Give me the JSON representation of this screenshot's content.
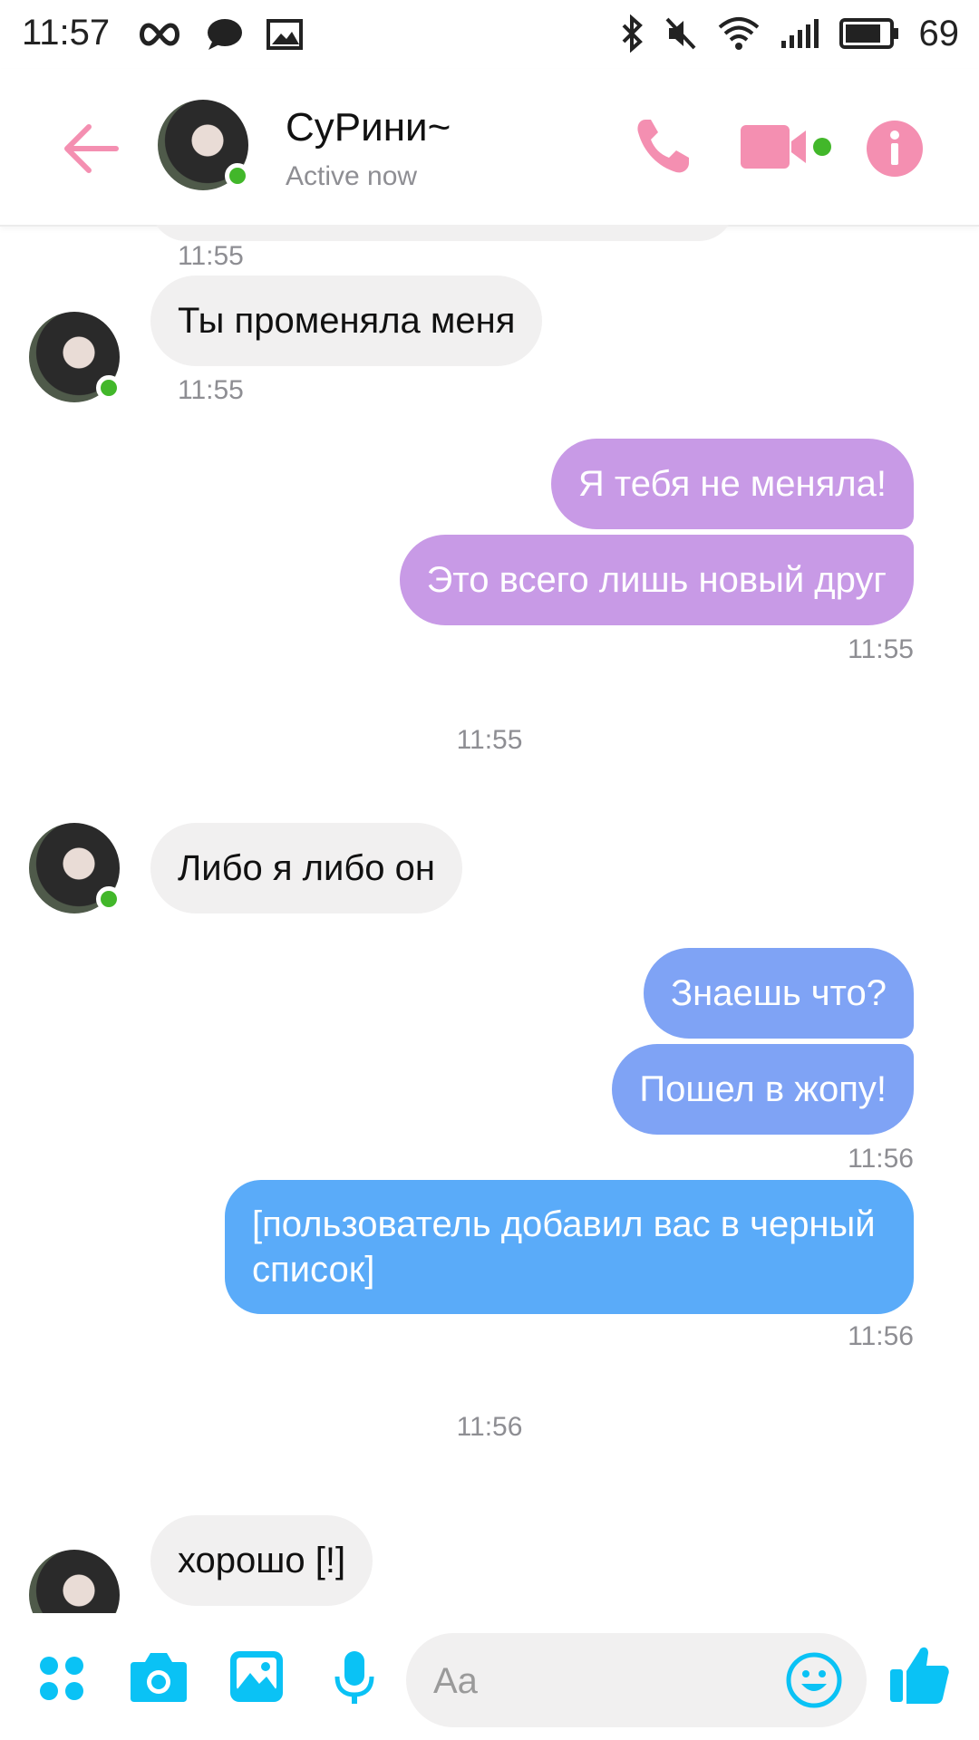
{
  "status_bar": {
    "time": "11:57",
    "battery_percent": "69",
    "icons": [
      "infinity-icon",
      "chat-bubble-icon",
      "image-icon",
      "bluetooth-icon",
      "mute-icon",
      "wifi-icon",
      "signal-icon",
      "battery-icon"
    ]
  },
  "header": {
    "contact_name": "СуРини~",
    "status": "Active now",
    "accent_color": "#f48fb1",
    "online_color": "#42b72a"
  },
  "messages": [
    {
      "side": "in-partial",
      "time": "11:55"
    },
    {
      "side": "in",
      "text": "Ты променяла меня",
      "time": "11:55",
      "avatar": true
    },
    {
      "side": "out",
      "text": "Я тебя не меняла!",
      "color": "#c89ae6"
    },
    {
      "side": "out",
      "text": "Это всего лишь новый друг",
      "color": "#c89ae6",
      "time": "11:55"
    },
    {
      "side": "divider",
      "time": "11:55"
    },
    {
      "side": "in",
      "text": "Либо я либо он",
      "avatar": true
    },
    {
      "side": "out",
      "text": "Знаешь что?",
      "color": "#7fa3f5"
    },
    {
      "side": "out",
      "text": "Пошел в жопу!",
      "color": "#7fa3f5",
      "time": "11:56"
    },
    {
      "side": "out",
      "text": "[пользователь добавил вас в черный список]",
      "color": "#5aabf9",
      "time": "11:56"
    },
    {
      "side": "divider",
      "time": "11:56"
    },
    {
      "side": "in",
      "text": "хорошо [!]",
      "avatar": true
    }
  ],
  "composer": {
    "placeholder": "Aa",
    "accent_color": "#0ac2f5",
    "icons": [
      "apps-grid-icon",
      "camera-icon",
      "gallery-icon",
      "microphone-icon",
      "emoji-icon",
      "thumbs-up-icon"
    ]
  }
}
